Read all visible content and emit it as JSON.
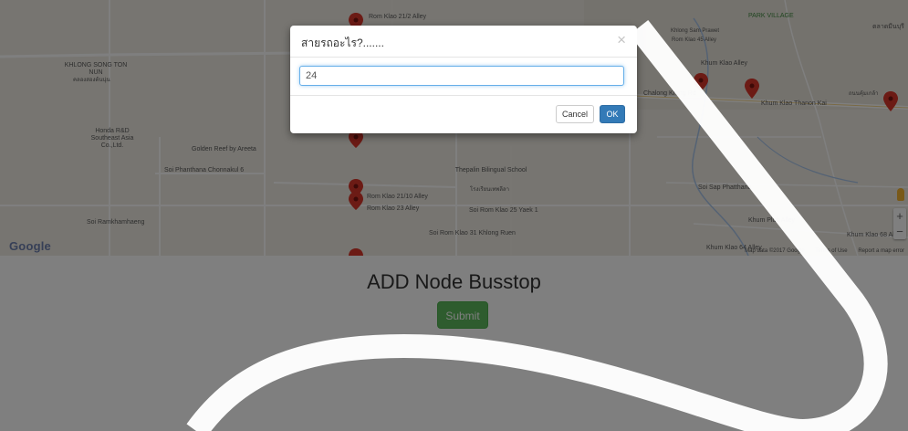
{
  "map": {
    "provider_logo": "Google",
    "footer": {
      "map_data": "Map data ©2017 Google",
      "terms": "Terms of Use",
      "report": "Report a map error"
    },
    "zoom_in": "+",
    "zoom_out": "−",
    "labels": [
      "Rom Klao 21/2 Alley",
      "KHLONG SONG TON NUN",
      "คลองสองต้นนุ่น",
      "Honda R&D Southeast Asia Co.,Ltd.",
      "Golden Reef by Areeta",
      "Soi Phanthana Chonnakul 6",
      "Soi Ramkhamhaeng",
      "Rom Klao 21/10 Alley",
      "Rom Klao 23 Alley",
      "Thepalin Bilingual School",
      "โรงเรียนเทพลีลา",
      "Soi Rom Klao 25 Yaek 1",
      "Soi Rom Klao 31 Khlong Ruen",
      "Rom Klao 45 Alley",
      "Khlong Sam Prawet",
      "Khum Klao Alley",
      "Chalong Krung Rd",
      "Khum Klao Thanon Kai",
      "ถนนคุ้มเกล้า",
      "Soi Sap Phatthana",
      "Khum Plub Alley",
      "Khum Klao 64 Alley",
      "Khum Klao 68 Alley",
      "PARK VILLAGE",
      "ตลาดมีนบุรี"
    ]
  },
  "prompt": {
    "title": "สายรถอะไร?.......",
    "close": "×",
    "input_value": "24",
    "cancel_label": "Cancel",
    "ok_label": "OK"
  },
  "page": {
    "heading": "ADD Node Busstop",
    "submit_label": "Submit"
  },
  "colors": {
    "backdrop": "rgba(0,0,0,0.5)",
    "primary": "#337ab7",
    "success": "#5cb85c",
    "marker": "#d9362b"
  }
}
